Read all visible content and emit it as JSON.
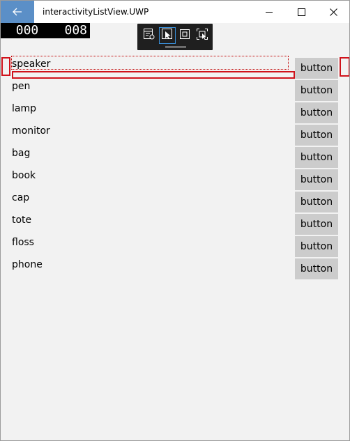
{
  "window": {
    "title": "interactivityListView.UWP"
  },
  "counters": {
    "left": "000",
    "right": "008"
  },
  "list": {
    "items": [
      {
        "label": "speaker",
        "button": "button"
      },
      {
        "label": "pen",
        "button": "button"
      },
      {
        "label": "lamp",
        "button": "button"
      },
      {
        "label": "monitor",
        "button": "button"
      },
      {
        "label": "bag",
        "button": "button"
      },
      {
        "label": "book",
        "button": "button"
      },
      {
        "label": "cap",
        "button": "button"
      },
      {
        "label": "tote",
        "button": "button"
      },
      {
        "label": "floss",
        "button": "button"
      },
      {
        "label": "phone",
        "button": "button"
      }
    ]
  },
  "colors": {
    "accent": "#5b8fc7",
    "highlight": "#d0121b",
    "button_bg": "#cccccc"
  }
}
